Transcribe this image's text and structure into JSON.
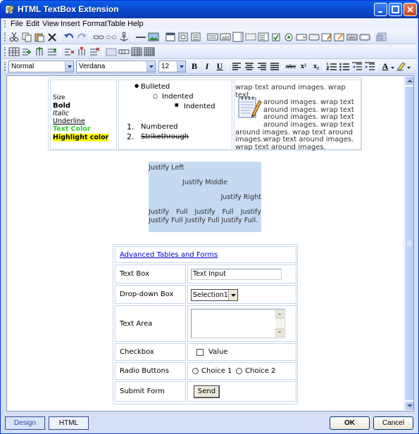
{
  "window": {
    "title": "HTML TextBox Extension"
  },
  "menu": [
    "File",
    "Edit",
    "View",
    "Insert",
    "Format",
    "Table",
    "Help"
  ],
  "format_bar": {
    "style": "Normal",
    "font": "Verdana",
    "size": "12",
    "bold": "B",
    "italic": "I",
    "underline": "U",
    "strikethrough": "abc",
    "superscript": "x²",
    "subscript": "x₂",
    "font_color": "A"
  },
  "formats": {
    "size": "Size",
    "bold": "Bold",
    "italic": "Italic",
    "underline": "Underline",
    "text_color": "Text Color",
    "highlight": "Highlight color"
  },
  "lists": {
    "bulleted": "Bulleted",
    "indented1": "Indented",
    "indented2": "Indented",
    "num1": "1.",
    "num2": "2.",
    "numbered": "Numbered",
    "strikethrough": "Strikethrough"
  },
  "wrap": {
    "line1": "wrap text around images. wrap text",
    "line2": "around images. wrap text",
    "line3": "around images. wrap text",
    "line4": "around images. wrap text",
    "line5": "around images. wrap text",
    "line6": "around images. wrap text around",
    "line7": "images.wrap text around images.",
    "line8": "wrap text around images."
  },
  "justify": {
    "left": "Justify Left",
    "middle": "Justify Middle",
    "right": "Justify Right",
    "full1": [
      "Justify",
      "Full",
      "Justify",
      "Full",
      "Justify"
    ],
    "full2": "Justify Full Justify Full Justify Full."
  },
  "form": {
    "link": "Advanced Tables and Forms",
    "text_box_label": "Text Box",
    "text_box_value": "Text Input",
    "dropdown_label": "Drop-down Box",
    "dropdown_value": "Selection1",
    "textarea_label": "Text Area",
    "checkbox_label": "Checkbox",
    "checkbox_value": "Value",
    "radio_label": "Radio Buttons",
    "choice1": "Choice 1",
    "choice2": "Choice 2",
    "submit_label": "Submit Form",
    "send": "Send"
  },
  "tabs": {
    "design": "Design",
    "html": "HTML"
  },
  "buttons": {
    "ok": "OK",
    "cancel": "Cancel"
  },
  "colors": {
    "text_color": "#33cc33",
    "highlight": "#ffff00",
    "justify_bg": "#c5d9f1",
    "link": "#0000cc"
  }
}
